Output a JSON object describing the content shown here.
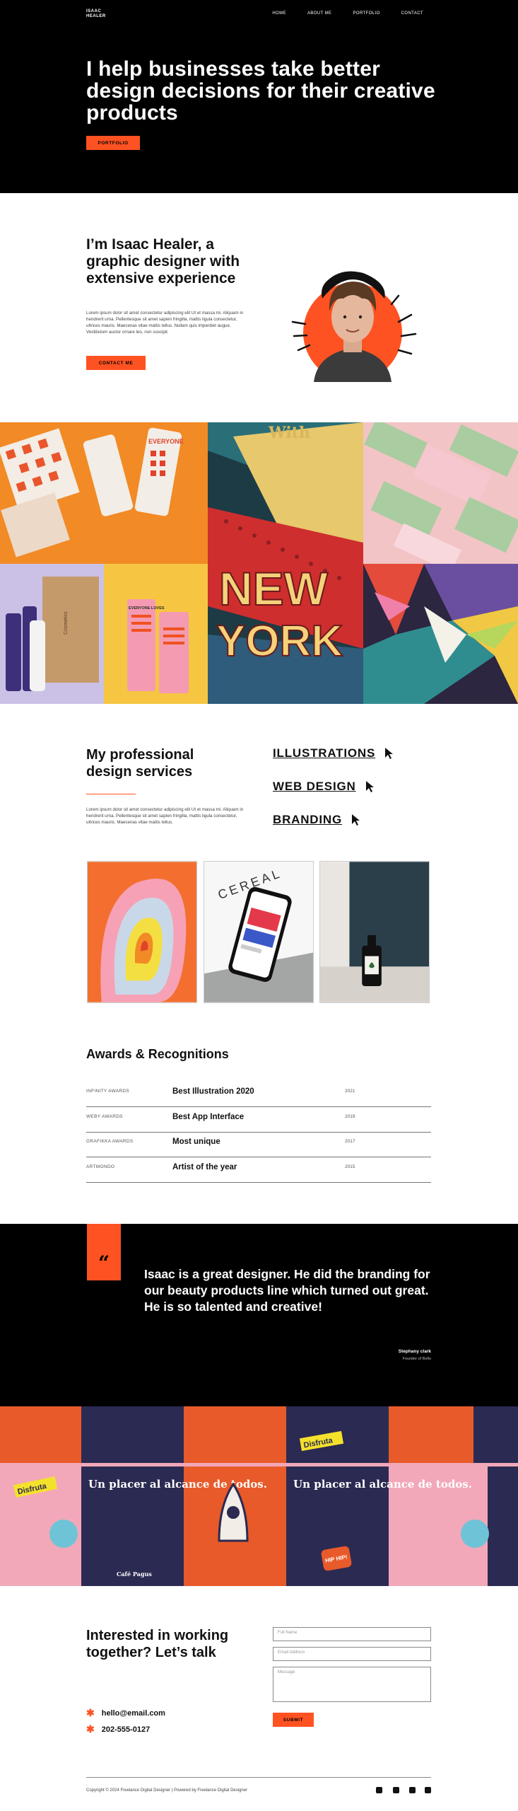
{
  "header": {
    "logo": "ISAAC\nHEALER",
    "nav": [
      "HOME",
      "ABOUT ME",
      "PORTFOLIO",
      "CONTACT"
    ]
  },
  "hero": {
    "title": "I help businesses take better design decisions for their creative products",
    "button": "PORTFOLIO"
  },
  "about": {
    "title": "I’m Isaac Healer, a graphic designer with extensive experience",
    "body": "Lorem ipsum dolor sit amet consectetur adipiscing elit Ut et massa mi. Aliquam in hendrerit urna. Pellentesque sit amet sapien fringilla, mattis ligula consectetur, ultrices mauris. Maecenas vitae mattis tellus. Nullam quis imperdiet augue. Vestibulum auctor ornare leo, non suscipit.",
    "button": "CONTACT ME"
  },
  "grid": {
    "can_text": "EVERYONE",
    "tube_text": "EVERYONE LOVES",
    "box_text": "Cosmetics",
    "poster_text_1": "NEW",
    "poster_text_2": "YORK",
    "poster_top": "With"
  },
  "services": {
    "title": "My professional design services",
    "body": "Lorem ipsum dolor sit amet consectetur adipiscing elit Ut et massa mi. Aliquam in hendrerit urna. Pellentesque sit amet sapien fringilla, mattis ligula consectetur, ultrices mauris. Maecenas vitae mattis tellus.",
    "links": [
      "ILLUSTRATIONS",
      "WEB DESIGN",
      "BRANDING"
    ],
    "tile_cereal": "CEREAL"
  },
  "awards": {
    "title": "Awards & Recognitions",
    "rows": [
      {
        "org": "INFINITY AWARDS",
        "name": "Best Illustration 2020",
        "year": "2021"
      },
      {
        "org": "WEBY AWARDS",
        "name": "Best App Interface",
        "year": "2019"
      },
      {
        "org": "GRAFIKKA AWARDS",
        "name": "Most unique",
        "year": "2017"
      },
      {
        "org": "ARTMONDO",
        "name": "Artist of the year",
        "year": "2015"
      }
    ]
  },
  "testimonial": {
    "quote_mark": "“",
    "text": "Isaac is a great designer. He did the branding for our beauty products line which turned out great. He is so talented and creative!",
    "author": "Stephany clark",
    "role": "Founder of Bello"
  },
  "pattern": {
    "headline": "Un placer al alcance de todos.",
    "sticker": "Disfruta",
    "hip": "HIP HIP!",
    "cafe": "Café Pagus"
  },
  "contact": {
    "title": "Interested in working together? Let’s talk",
    "email": "hello@email.com",
    "phone": "202-555-0127",
    "name_placeholder": "Full Name",
    "email_placeholder": "Email Address",
    "message_placeholder": "Message",
    "submit": "SUBMIT"
  },
  "footer": {
    "copyright": "Copyright © 2024 Freelance Digital Designer  |  Powered by Freelance Digital Designer",
    "socials": [
      "youtube-icon",
      "facebook-icon",
      "instagram-icon",
      "linkedin-icon"
    ]
  },
  "colors": {
    "accent": "#ff5222",
    "dark": "#000000"
  }
}
